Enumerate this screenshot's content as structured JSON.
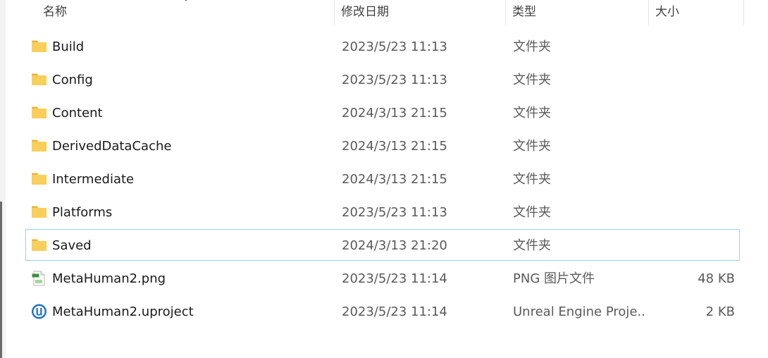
{
  "columns": {
    "name": "名称",
    "date": "修改日期",
    "type": "类型",
    "size": "大小"
  },
  "files": [
    {
      "name": "Build",
      "date": "2023/5/23 11:13",
      "type": "文件夹",
      "size": "",
      "icon": "folder-icon"
    },
    {
      "name": "Config",
      "date": "2023/5/23 11:13",
      "type": "文件夹",
      "size": "",
      "icon": "folder-icon"
    },
    {
      "name": "Content",
      "date": "2024/3/13 21:15",
      "type": "文件夹",
      "size": "",
      "icon": "folder-icon"
    },
    {
      "name": "DerivedDataCache",
      "date": "2024/3/13 21:15",
      "type": "文件夹",
      "size": "",
      "icon": "folder-icon"
    },
    {
      "name": "Intermediate",
      "date": "2024/3/13 21:15",
      "type": "文件夹",
      "size": "",
      "icon": "folder-icon"
    },
    {
      "name": "Platforms",
      "date": "2023/5/23 11:13",
      "type": "文件夹",
      "size": "",
      "icon": "folder-icon"
    },
    {
      "name": "Saved",
      "date": "2024/3/13 21:20",
      "type": "文件夹",
      "size": "",
      "icon": "folder-icon"
    },
    {
      "name": "MetaHuman2.png",
      "date": "2023/5/23 11:14",
      "type": "PNG 图片文件",
      "size": "48 KB",
      "icon": "png-file-icon"
    },
    {
      "name": "MetaHuman2.uproject",
      "date": "2023/5/23 11:14",
      "type": "Unreal Engine Proje...",
      "size": "2 KB",
      "icon": "unreal-engine-icon"
    }
  ],
  "colors": {
    "folder": "#f8cf5a",
    "folder_dark": "#e9b43c",
    "selection_border": "#99d1e8",
    "unreal_blue": "#1e73c8"
  }
}
